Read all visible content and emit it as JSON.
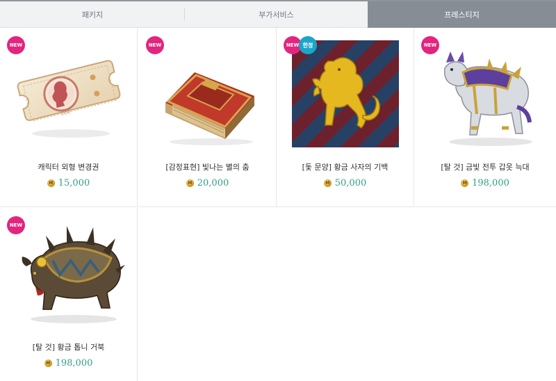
{
  "tabs": [
    {
      "label": "패키지",
      "active": false
    },
    {
      "label": "부가서비스",
      "active": false
    },
    {
      "label": "프레스티지",
      "active": true
    }
  ],
  "badges": {
    "new": "NEW",
    "limited": "한정"
  },
  "currency_icon": "M",
  "items": [
    {
      "title": "캐릭터 외형 변경권",
      "price": "15,000",
      "icon": "appearance-ticket-icon",
      "badges": [
        "NEW"
      ]
    },
    {
      "title": "[감정표현] 빛나는 별의 춤",
      "price": "20,000",
      "icon": "emote-book-icon",
      "badges": [
        "NEW"
      ]
    },
    {
      "title": "[돛 문양] 황금 사자의 기백",
      "price": "50,000",
      "icon": "golden-lion-sail-icon",
      "badges": [
        "NEW",
        "한정"
      ]
    },
    {
      "title": "[탈 것] 금빛 전투 갑옷 늑대",
      "price": "198,000",
      "icon": "armored-wolf-mount-icon",
      "badges": [
        "NEW"
      ]
    },
    {
      "title": "[탈 것] 황금 톱니 거북",
      "price": "198,000",
      "icon": "golden-spike-turtle-mount-icon",
      "badges": [
        "NEW"
      ]
    }
  ],
  "colors": {
    "new_badge": "#e2257f",
    "limited_badge": "#1aa6c8",
    "price": "#2f9e86",
    "active_tab": "#878d95"
  }
}
